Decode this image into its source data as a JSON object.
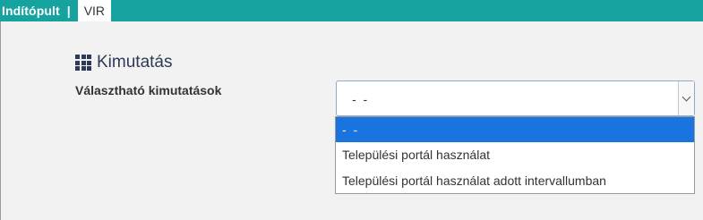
{
  "topbar": {
    "home_label": "Indítópult",
    "separator": "|",
    "active_tab_label": "VIR"
  },
  "section": {
    "title": "Kimutatás",
    "icon": "grid-icon"
  },
  "form": {
    "label": "Választható kimutatások",
    "select": {
      "selected_value": "- -",
      "options": [
        {
          "label": "- -",
          "selected": true
        },
        {
          "label": "Települési portál használat",
          "selected": false
        },
        {
          "label": "Települési portál használat adott intervallumban",
          "selected": false
        }
      ]
    }
  },
  "colors": {
    "topbar": "#16a3a0",
    "title": "#2e3a57",
    "option_highlight": "#1a74e0",
    "background": "#f2f2f2"
  }
}
